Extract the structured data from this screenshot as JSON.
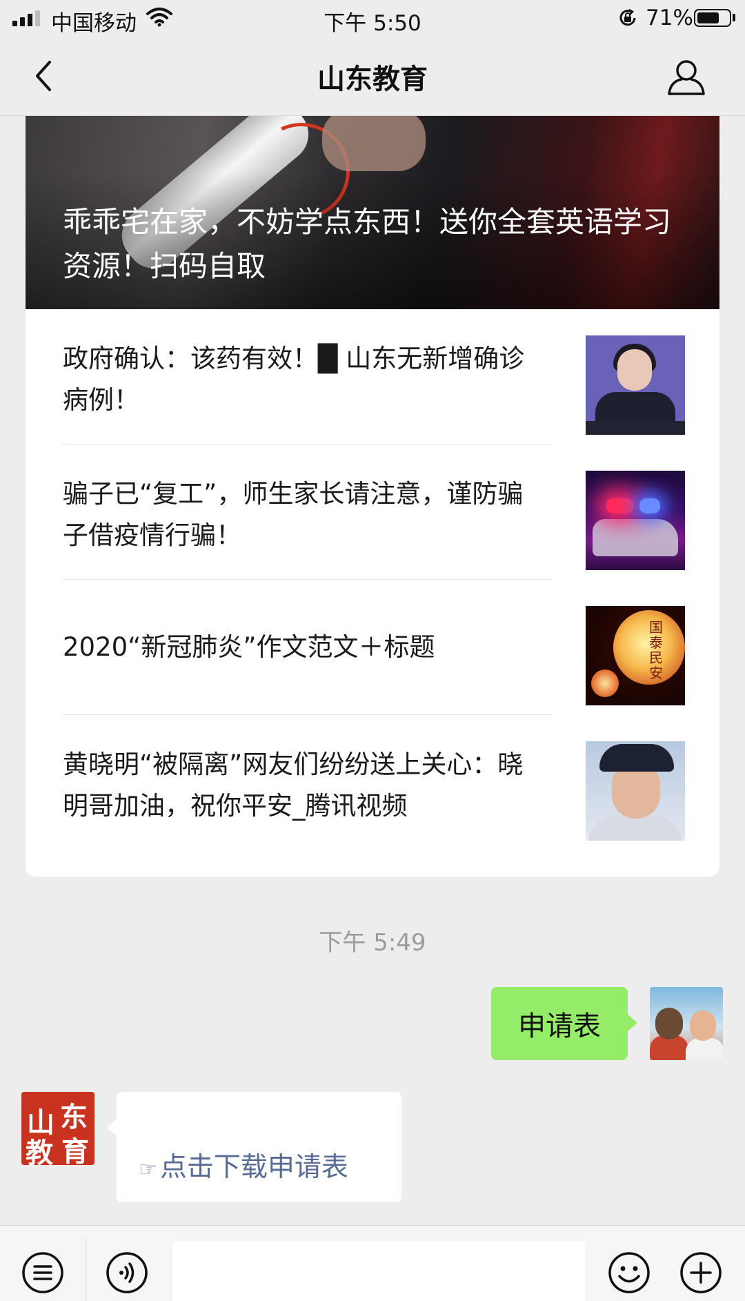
{
  "status_bar": {
    "carrier": "中国移动",
    "time": "下午 5:50",
    "battery_percent_label": "71%",
    "battery_level": 0.71
  },
  "nav": {
    "title": "山东教育"
  },
  "article_card": {
    "hero": {
      "title": "乖乖宅在家，不妨学点东西！送你全套英语学习资源！扫码自取"
    },
    "items": [
      {
        "title": "政府确认：该药有效！█ 山东无新增确诊病例！",
        "thumb_icon": "press-conference-photo"
      },
      {
        "title": "骗子已“复工”，师生家长请注意，谨防骗子借疫情行骗！",
        "thumb_icon": "police-car-photo"
      },
      {
        "title": "2020“新冠肺炎”作文范文＋标题",
        "thumb_icon": "lantern-photo",
        "thumb_glyphs": "国泰民安"
      },
      {
        "title": "黄晓明“被隔离”网友们纷纷送上关心：晓明哥加油，祝你平安_腾讯视频",
        "thumb_icon": "portrait-photo"
      }
    ]
  },
  "chat": {
    "timestamp": "下午 5:49",
    "sent_message": "申请表",
    "received_message": {
      "hand_glyph": "☞",
      "link_text": "点击下载申请表"
    },
    "official_avatar_glyphs": [
      "山",
      "东",
      "教",
      "育"
    ]
  },
  "input_bar": {
    "placeholder": ""
  },
  "colors": {
    "background": "#ededed",
    "sent_bubble": "#95ec69",
    "link": "#576b95",
    "official_avatar": "#c9321f"
  }
}
